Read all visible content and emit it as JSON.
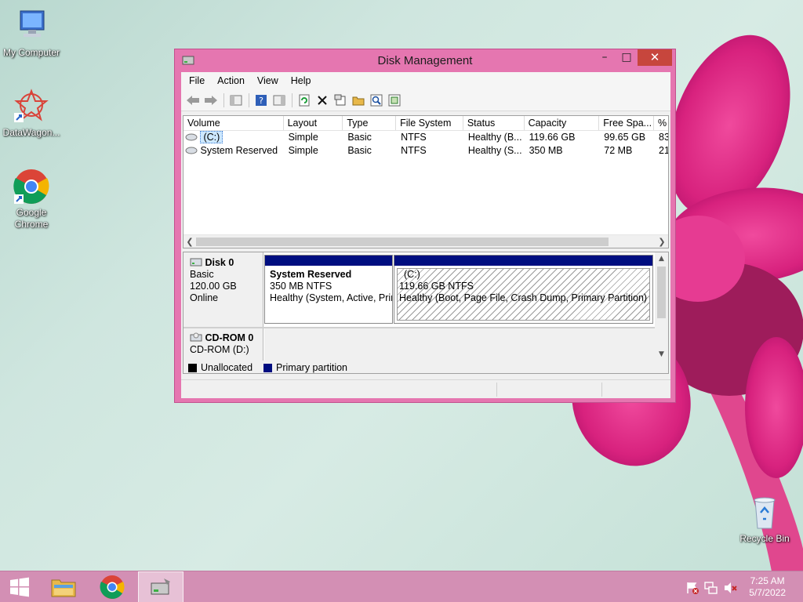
{
  "desktop": {
    "icons": [
      {
        "label": "My Computer"
      },
      {
        "label": "DataWagon..."
      },
      {
        "label": "Google Chrome"
      },
      {
        "label": "Recycle Bin"
      }
    ]
  },
  "window": {
    "title": "Disk Management",
    "controls": {
      "minimize": "–",
      "maximize": "□",
      "close": "✕"
    }
  },
  "menu": [
    "File",
    "Action",
    "View",
    "Help"
  ],
  "volume_list": {
    "columns": [
      "Volume",
      "Layout",
      "Type",
      "File System",
      "Status",
      "Capacity",
      "Free Spa...",
      "% F"
    ],
    "rows": [
      {
        "volume": "(C:)",
        "layout": "Simple",
        "type": "Basic",
        "fs": "NTFS",
        "status": "Healthy (B...",
        "capacity": "119.66 GB",
        "free": "99.65 GB",
        "pct": "83"
      },
      {
        "volume": "System Reserved",
        "layout": "Simple",
        "type": "Basic",
        "fs": "NTFS",
        "status": "Healthy (S...",
        "capacity": "350 MB",
        "free": "72 MB",
        "pct": "21"
      }
    ]
  },
  "disks": {
    "disk0": {
      "name": "Disk 0",
      "type": "Basic",
      "size": "120.00 GB",
      "state": "Online"
    },
    "cdrom0": {
      "name": "CD-ROM 0",
      "sub": "CD-ROM (D:)"
    }
  },
  "partitions": {
    "reserved": {
      "title": "System Reserved",
      "size": "350 MB NTFS",
      "status": "Healthy (System, Active, Prir"
    },
    "c": {
      "title": "(C:)",
      "size": "119.66 GB NTFS",
      "status": "Healthy (Boot, Page File, Crash Dump, Primary Partition)"
    }
  },
  "legend": {
    "unallocated": "Unallocated",
    "primary": "Primary partition"
  },
  "colors": {
    "primary": "#000e80",
    "unallocated": "#000000"
  },
  "taskbar": {
    "time": "7:25 AM",
    "date": "5/7/2022"
  }
}
